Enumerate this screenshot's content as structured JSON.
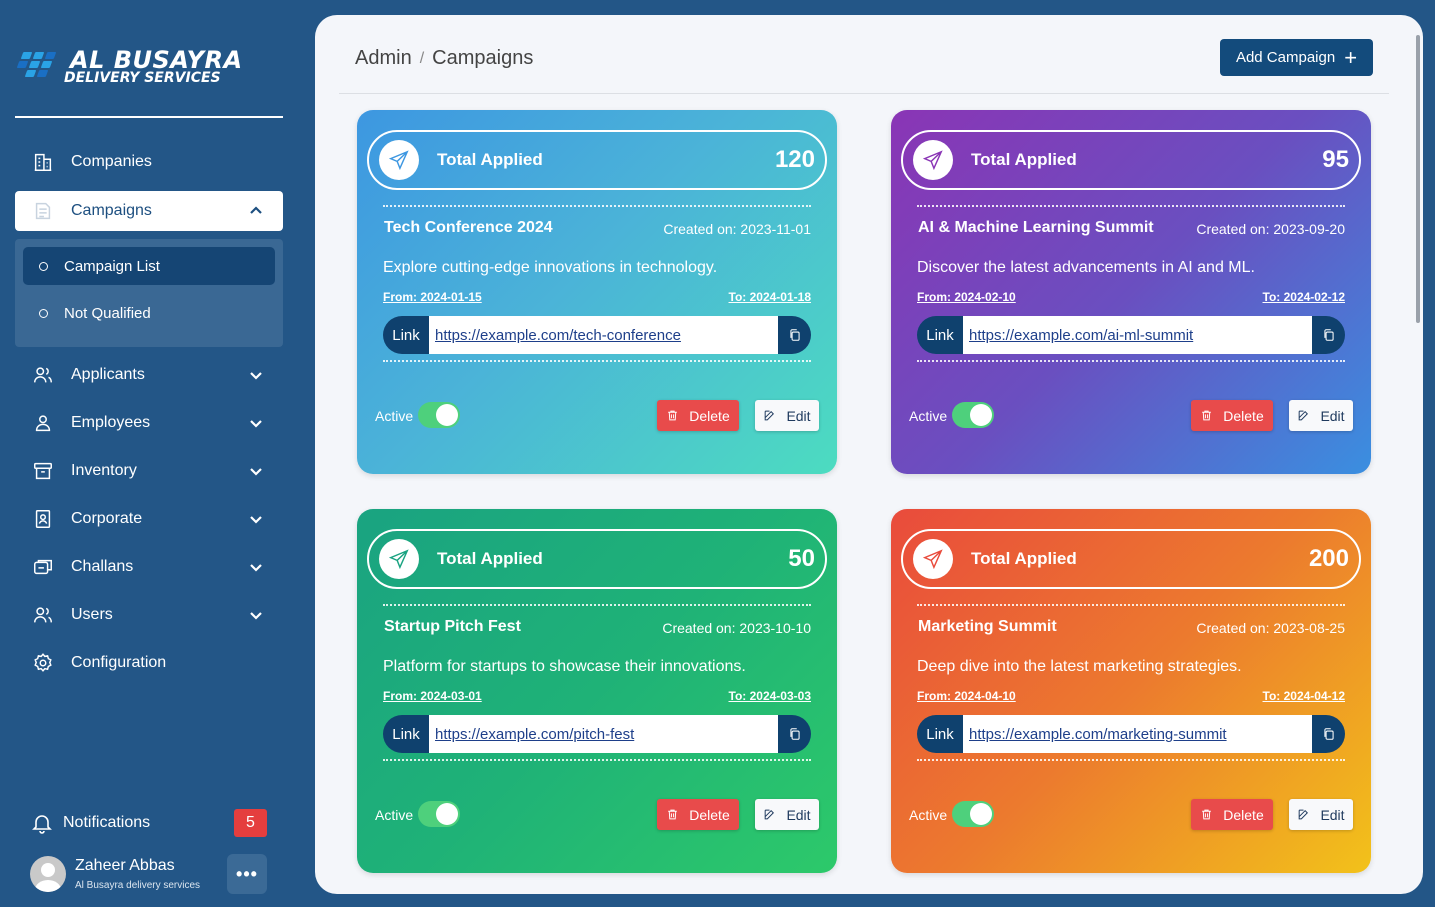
{
  "brand": {
    "line1": "AL BUSAYRA",
    "line2": "DELIVERY SERVICES"
  },
  "sidebar": {
    "items": [
      {
        "label": "Companies",
        "icon": "building-icon",
        "expandable": false
      },
      {
        "label": "Campaigns",
        "icon": "campaign-icon",
        "expandable": true,
        "expanded": true
      },
      {
        "label": "Applicants",
        "icon": "users-icon",
        "expandable": true
      },
      {
        "label": "Employees",
        "icon": "user-icon",
        "expandable": true
      },
      {
        "label": "Inventory",
        "icon": "archive-icon",
        "expandable": true
      },
      {
        "label": "Corporate",
        "icon": "id-badge-icon",
        "expandable": true
      },
      {
        "label": "Challans",
        "icon": "documents-icon",
        "expandable": true
      },
      {
        "label": "Users",
        "icon": "users-icon",
        "expandable": true
      },
      {
        "label": "Configuration",
        "icon": "gear-icon",
        "expandable": false
      }
    ],
    "submenu": [
      {
        "label": "Campaign List",
        "active": true
      },
      {
        "label": "Not Qualified",
        "active": false
      }
    ],
    "notifications": {
      "label": "Notifications",
      "count": "5"
    },
    "user": {
      "name": "Zaheer Abbas",
      "org": "Al Busayra delivery services",
      "more": "•••"
    }
  },
  "header": {
    "breadcrumb": [
      "Admin",
      "Campaigns"
    ],
    "separator": "/",
    "add_button": "Add Campaign",
    "add_icon": "+"
  },
  "labels": {
    "total_applied": "Total Applied",
    "link": "Link",
    "active": "Active",
    "delete": "Delete",
    "edit": "Edit"
  },
  "campaigns": [
    {
      "total": "120",
      "name": "Tech Conference 2024",
      "created": "Created on: 2023-11-01",
      "description": "Explore cutting-edge innovations in technology.",
      "from": "From: 2024-01-15",
      "to": "To: 2024-01-18",
      "url": "https://example.com/tech-conference",
      "active": true,
      "accent": "#3d97e1"
    },
    {
      "total": "95",
      "name": "AI & Machine Learning Summit",
      "created": "Created on: 2023-09-20",
      "description": "Discover the latest advancements in AI and ML.",
      "from": "From: 2024-02-10",
      "to": "To: 2024-02-12",
      "url": "https://example.com/ai-ml-summit",
      "active": true,
      "accent": "#8a35b5"
    },
    {
      "total": "50",
      "name": "Startup Pitch Fest",
      "created": "Created on: 2023-10-10",
      "description": "Platform for startups to showcase their innovations.",
      "from": "From: 2024-03-01",
      "to": "To: 2024-03-03",
      "url": "https://example.com/pitch-fest",
      "active": true,
      "accent": "#1aa381"
    },
    {
      "total": "200",
      "name": "Marketing Summit",
      "created": "Created on: 2023-08-25",
      "description": "Deep dive into the latest marketing strategies.",
      "from": "From: 2024-04-10",
      "to": "To: 2024-04-12",
      "url": "https://example.com/marketing-summit",
      "active": true,
      "accent": "#e94b3c"
    }
  ],
  "colors": {
    "sidebar_bg": "#235687",
    "primary": "#134b7c",
    "danger": "#e84b4b",
    "toggle_on": "#4ed07c"
  }
}
